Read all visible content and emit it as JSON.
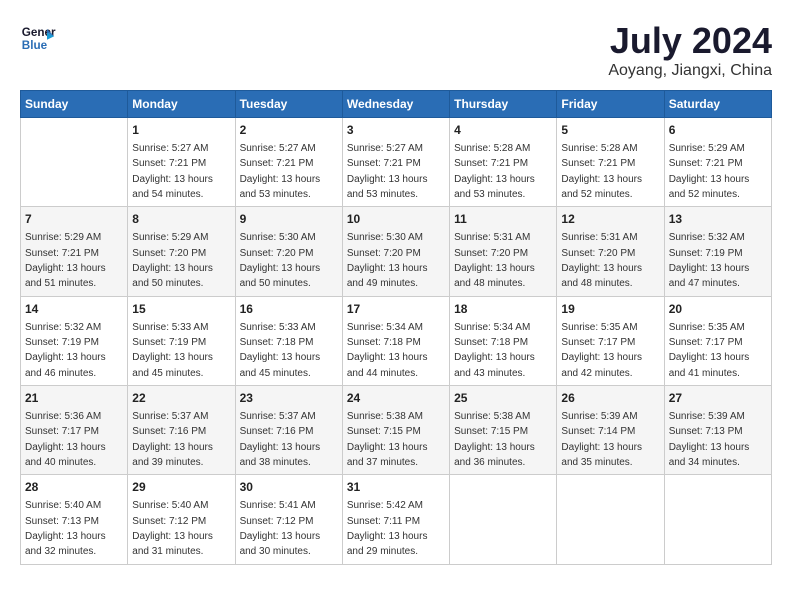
{
  "header": {
    "logo_line1": "General",
    "logo_line2": "Blue",
    "month": "July 2024",
    "location": "Aoyang, Jiangxi, China"
  },
  "weekdays": [
    "Sunday",
    "Monday",
    "Tuesday",
    "Wednesday",
    "Thursday",
    "Friday",
    "Saturday"
  ],
  "weeks": [
    [
      {
        "day": "",
        "info": ""
      },
      {
        "day": "1",
        "info": "Sunrise: 5:27 AM\nSunset: 7:21 PM\nDaylight: 13 hours\nand 54 minutes."
      },
      {
        "day": "2",
        "info": "Sunrise: 5:27 AM\nSunset: 7:21 PM\nDaylight: 13 hours\nand 53 minutes."
      },
      {
        "day": "3",
        "info": "Sunrise: 5:27 AM\nSunset: 7:21 PM\nDaylight: 13 hours\nand 53 minutes."
      },
      {
        "day": "4",
        "info": "Sunrise: 5:28 AM\nSunset: 7:21 PM\nDaylight: 13 hours\nand 53 minutes."
      },
      {
        "day": "5",
        "info": "Sunrise: 5:28 AM\nSunset: 7:21 PM\nDaylight: 13 hours\nand 52 minutes."
      },
      {
        "day": "6",
        "info": "Sunrise: 5:29 AM\nSunset: 7:21 PM\nDaylight: 13 hours\nand 52 minutes."
      }
    ],
    [
      {
        "day": "7",
        "info": "Sunrise: 5:29 AM\nSunset: 7:21 PM\nDaylight: 13 hours\nand 51 minutes."
      },
      {
        "day": "8",
        "info": "Sunrise: 5:29 AM\nSunset: 7:20 PM\nDaylight: 13 hours\nand 50 minutes."
      },
      {
        "day": "9",
        "info": "Sunrise: 5:30 AM\nSunset: 7:20 PM\nDaylight: 13 hours\nand 50 minutes."
      },
      {
        "day": "10",
        "info": "Sunrise: 5:30 AM\nSunset: 7:20 PM\nDaylight: 13 hours\nand 49 minutes."
      },
      {
        "day": "11",
        "info": "Sunrise: 5:31 AM\nSunset: 7:20 PM\nDaylight: 13 hours\nand 48 minutes."
      },
      {
        "day": "12",
        "info": "Sunrise: 5:31 AM\nSunset: 7:20 PM\nDaylight: 13 hours\nand 48 minutes."
      },
      {
        "day": "13",
        "info": "Sunrise: 5:32 AM\nSunset: 7:19 PM\nDaylight: 13 hours\nand 47 minutes."
      }
    ],
    [
      {
        "day": "14",
        "info": "Sunrise: 5:32 AM\nSunset: 7:19 PM\nDaylight: 13 hours\nand 46 minutes."
      },
      {
        "day": "15",
        "info": "Sunrise: 5:33 AM\nSunset: 7:19 PM\nDaylight: 13 hours\nand 45 minutes."
      },
      {
        "day": "16",
        "info": "Sunrise: 5:33 AM\nSunset: 7:18 PM\nDaylight: 13 hours\nand 45 minutes."
      },
      {
        "day": "17",
        "info": "Sunrise: 5:34 AM\nSunset: 7:18 PM\nDaylight: 13 hours\nand 44 minutes."
      },
      {
        "day": "18",
        "info": "Sunrise: 5:34 AM\nSunset: 7:18 PM\nDaylight: 13 hours\nand 43 minutes."
      },
      {
        "day": "19",
        "info": "Sunrise: 5:35 AM\nSunset: 7:17 PM\nDaylight: 13 hours\nand 42 minutes."
      },
      {
        "day": "20",
        "info": "Sunrise: 5:35 AM\nSunset: 7:17 PM\nDaylight: 13 hours\nand 41 minutes."
      }
    ],
    [
      {
        "day": "21",
        "info": "Sunrise: 5:36 AM\nSunset: 7:17 PM\nDaylight: 13 hours\nand 40 minutes."
      },
      {
        "day": "22",
        "info": "Sunrise: 5:37 AM\nSunset: 7:16 PM\nDaylight: 13 hours\nand 39 minutes."
      },
      {
        "day": "23",
        "info": "Sunrise: 5:37 AM\nSunset: 7:16 PM\nDaylight: 13 hours\nand 38 minutes."
      },
      {
        "day": "24",
        "info": "Sunrise: 5:38 AM\nSunset: 7:15 PM\nDaylight: 13 hours\nand 37 minutes."
      },
      {
        "day": "25",
        "info": "Sunrise: 5:38 AM\nSunset: 7:15 PM\nDaylight: 13 hours\nand 36 minutes."
      },
      {
        "day": "26",
        "info": "Sunrise: 5:39 AM\nSunset: 7:14 PM\nDaylight: 13 hours\nand 35 minutes."
      },
      {
        "day": "27",
        "info": "Sunrise: 5:39 AM\nSunset: 7:13 PM\nDaylight: 13 hours\nand 34 minutes."
      }
    ],
    [
      {
        "day": "28",
        "info": "Sunrise: 5:40 AM\nSunset: 7:13 PM\nDaylight: 13 hours\nand 32 minutes."
      },
      {
        "day": "29",
        "info": "Sunrise: 5:40 AM\nSunset: 7:12 PM\nDaylight: 13 hours\nand 31 minutes."
      },
      {
        "day": "30",
        "info": "Sunrise: 5:41 AM\nSunset: 7:12 PM\nDaylight: 13 hours\nand 30 minutes."
      },
      {
        "day": "31",
        "info": "Sunrise: 5:42 AM\nSunset: 7:11 PM\nDaylight: 13 hours\nand 29 minutes."
      },
      {
        "day": "",
        "info": ""
      },
      {
        "day": "",
        "info": ""
      },
      {
        "day": "",
        "info": ""
      }
    ]
  ]
}
